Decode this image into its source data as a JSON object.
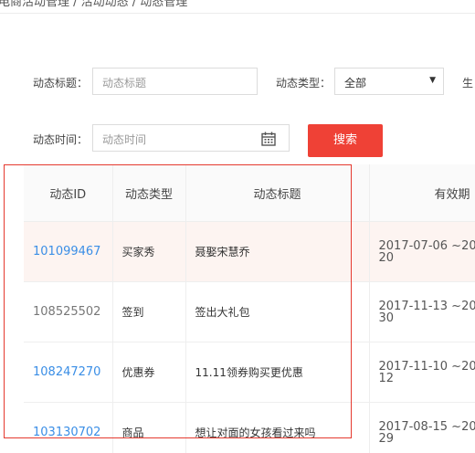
{
  "breadcrumb": "电商活动管理 / 活动动态 / 动态管理",
  "filters": {
    "title_label": "动态标题：",
    "title_placeholder": "动态标题",
    "type_label": "动态类型：",
    "type_value": "全部",
    "extra_label": "生",
    "time_label": "动态时间：",
    "time_placeholder": "动态时间",
    "search_label": "搜索"
  },
  "table": {
    "columns": [
      "动态ID",
      "动态类型",
      "动态标题",
      "有效期"
    ],
    "rows": [
      {
        "id": "101099467",
        "type": "买家秀",
        "title": "聂娶宋慧乔",
        "valid": "2017-07-06 ~20\n20"
      },
      {
        "id": "108525502",
        "type": "签到",
        "title": "签出大礼包",
        "valid": "2017-11-13 ~20\n30"
      },
      {
        "id": "108247270",
        "type": "优惠券",
        "title": "11.11领券购买更优惠",
        "valid": "2017-11-10 ~20\n12"
      },
      {
        "id": "103130702",
        "type": "商品",
        "title": "想让对面的女孩看过来吗",
        "valid": "2017-08-15 ~20\n29"
      }
    ]
  },
  "colors": {
    "accent": "#ef4136",
    "link": "#3a8ee6",
    "highlight": "#e53a2f"
  }
}
